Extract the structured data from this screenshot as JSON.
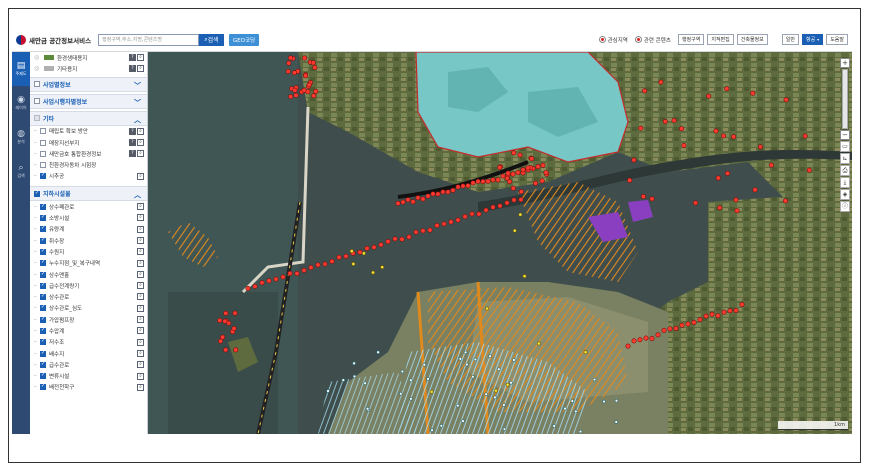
{
  "app": {
    "title": "새만금 공간정보서비스",
    "search_placeholder": "행정구역,주소,지명,콘텐츠명",
    "search_button": "검색",
    "geo_button": "GEO코딩"
  },
  "topbar": {
    "radio_interest": "관심지역",
    "radio_content": "관련 콘텐츠",
    "tools": [
      "행정구역",
      "지적편집",
      "건축물정보"
    ],
    "basemap": [
      "일반",
      "항공"
    ],
    "help": "도움말"
  },
  "rail": [
    {
      "label": "주제도",
      "icon": "layers-icon",
      "glyph": "▤"
    },
    {
      "label": "레이어",
      "icon": "pin-icon",
      "glyph": "◉"
    },
    {
      "label": "분석",
      "icon": "globe-icon",
      "glyph": "◍"
    },
    {
      "label": "검색",
      "icon": "search-icon",
      "glyph": "⌕"
    }
  ],
  "panel": {
    "top_items": [
      {
        "label": "환경생태용지",
        "color": "#5a8a3a"
      },
      {
        "label": "기타용지",
        "color": "#b0b0b0"
      }
    ],
    "section1": "사업별정보",
    "section2": "사업시행자별정보",
    "section3": "기타",
    "etc_items": [
      {
        "label": "매립토 확보 방안",
        "checked": false,
        "help": true
      },
      {
        "label": "매장지선부지",
        "checked": false,
        "help": true
      },
      {
        "label": "새만금호 통합환경정보",
        "checked": false,
        "help": true
      },
      {
        "label": "친환경자동차 시험장",
        "checked": false,
        "help": false
      },
      {
        "label": "시추공",
        "checked": true,
        "help": false
      }
    ],
    "section4": "지하시설물",
    "underground_items": [
      "상수폐관로",
      "소방시설",
      "유량계",
      "취수장",
      "수원지",
      "누수지점_및_복구내역",
      "상수맨홀",
      "급수전계량기",
      "상수관로",
      "상수관로_심도",
      "가압펌프장",
      "수압계",
      "저수조",
      "배수지",
      "급수관로",
      "변류시설",
      "배전천학구"
    ]
  },
  "map": {
    "scale_label": "1km"
  }
}
